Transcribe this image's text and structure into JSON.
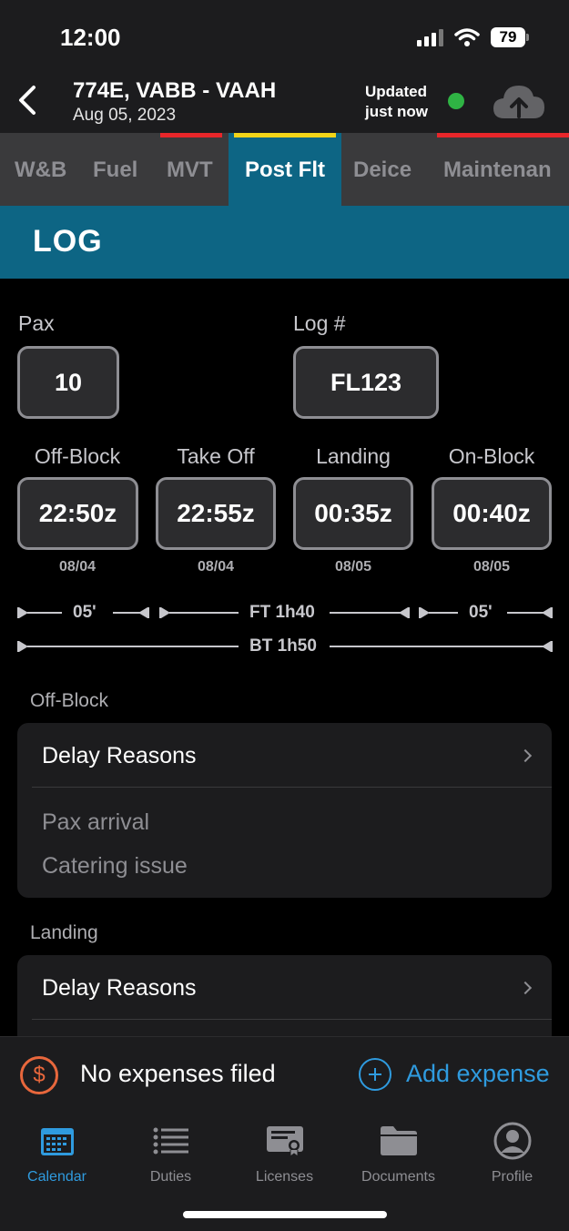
{
  "status_bar": {
    "time": "12:00",
    "battery": "79"
  },
  "header": {
    "title": "774E, VABB - VAAH",
    "date": "Aug 05, 2023",
    "updated_line1": "Updated",
    "updated_line2": "just now",
    "status_color": "#2fb344"
  },
  "tabs": [
    {
      "label": "W&B",
      "indicator": ""
    },
    {
      "label": "Fuel",
      "indicator": ""
    },
    {
      "label": "MVT",
      "indicator": "#e8262a"
    },
    {
      "label": "Post Flt",
      "indicator": "#f2d418",
      "active": true
    },
    {
      "label": "Deice",
      "indicator": ""
    },
    {
      "label": "Maintenan",
      "indicator": "#e8262a"
    }
  ],
  "section": {
    "title": "LOG"
  },
  "pax": {
    "label": "Pax",
    "value": "10"
  },
  "log": {
    "label": "Log #",
    "value": "FL123"
  },
  "times": [
    {
      "label": "Off-Block",
      "value": "22:50z",
      "date": "08/04"
    },
    {
      "label": "Take Off",
      "value": "22:55z",
      "date": "08/04"
    },
    {
      "label": "Landing",
      "value": "00:35z",
      "date": "08/05"
    },
    {
      "label": "On-Block",
      "value": "00:40z",
      "date": "08/05"
    }
  ],
  "timeline": {
    "taxi_out": "05'",
    "flight_time": "FT 1h40",
    "taxi_in": "05'",
    "block_time": "BT 1h50"
  },
  "offblock_group": {
    "label": "Off-Block",
    "row": "Delay Reasons",
    "items": [
      "Pax arrival",
      "Catering issue"
    ]
  },
  "landing_group": {
    "label": "Landing",
    "row": "Delay Reasons"
  },
  "expenses": {
    "status": "No expenses filed",
    "action": "Add expense"
  },
  "tabbar": [
    {
      "label": "Calendar",
      "icon": "calendar-icon",
      "active": true
    },
    {
      "label": "Duties",
      "icon": "list-icon"
    },
    {
      "label": "Licenses",
      "icon": "certificate-icon"
    },
    {
      "label": "Documents",
      "icon": "folder-icon"
    },
    {
      "label": "Profile",
      "icon": "person-icon"
    }
  ],
  "colors": {
    "accent": "#0d6584",
    "link": "#2f9bdf",
    "dollar": "#e8673c"
  }
}
